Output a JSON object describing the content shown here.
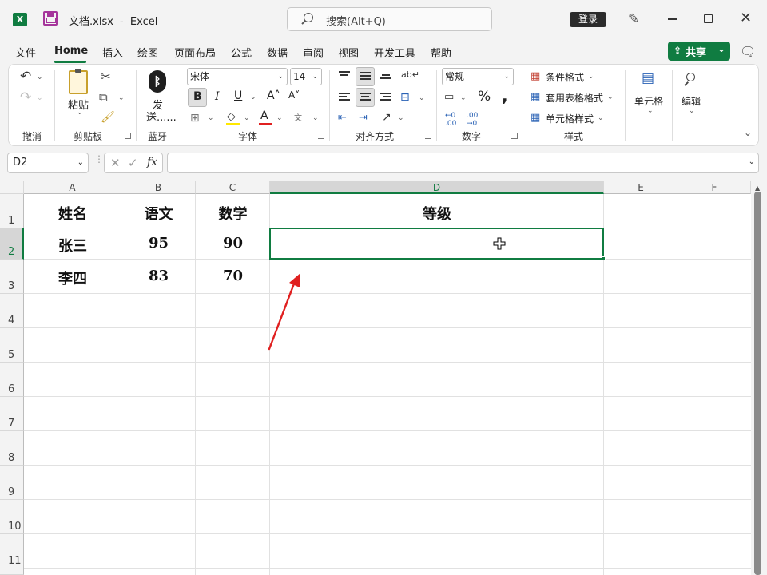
{
  "titlebar": {
    "filename": "文档.xlsx",
    "separator": "-",
    "app_name": "Excel",
    "search_placeholder": "搜索(Alt+Q)",
    "login_label": "登录"
  },
  "menu": {
    "tabs": [
      "文件",
      "Home",
      "插入",
      "绘图",
      "页面布局",
      "公式",
      "数据",
      "审阅",
      "视图",
      "开发工具",
      "帮助"
    ],
    "active_tab": "Home",
    "share_label": "共享"
  },
  "ribbon": {
    "groups": {
      "undo": "撤消",
      "clipboard": "剪贴板",
      "bluetooth": "蓝牙",
      "font": "字体",
      "alignment": "对齐方式",
      "number": "数字",
      "styles": "样式"
    },
    "paste_label": "粘贴",
    "send_label_line1": "发",
    "send_label_line2": "送......",
    "font_name": "宋体",
    "font_size": "14",
    "number_format": "常规",
    "conditional_format": "条件格式",
    "table_format": "套用表格格式",
    "cell_style": "单元格样式",
    "cells_label": "单元格",
    "edit_label": "编辑",
    "bold": "B",
    "italic": "I",
    "underline": "U",
    "percent": "%",
    "comma": ",",
    "phonetic": "文"
  },
  "formula_bar": {
    "name_box": "D2",
    "fx": "fx",
    "formula": ""
  },
  "sheet": {
    "columns": [
      "A",
      "B",
      "C",
      "D",
      "E",
      "F"
    ],
    "selected_column": "D",
    "rows": [
      "1",
      "2",
      "3",
      "4",
      "5",
      "6",
      "7",
      "8",
      "9",
      "10",
      "11"
    ],
    "selected_row": "2",
    "selected_cell": "D2",
    "cells": {
      "A1": "姓名",
      "B1": "语文",
      "C1": "数学",
      "D1": "等级",
      "A2": "张三",
      "B2": "95",
      "C2": "90",
      "A3": "李四",
      "B3": "83",
      "C3": "70"
    }
  },
  "colors": {
    "accent": "#107c41",
    "arrow": "#e02020"
  }
}
